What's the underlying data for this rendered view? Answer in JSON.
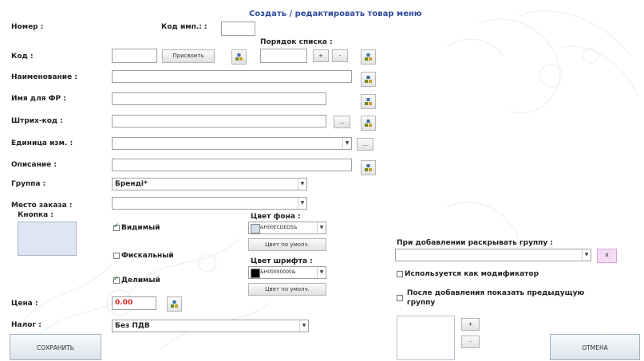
{
  "title": "Создать / редактировать товар меню",
  "labels": {
    "number": "Номер :",
    "import_code": "Код имп.: :",
    "list_order": "Порядок списка :",
    "code": "Код :",
    "name": "Наименование :",
    "fr_name": "Имя для ФР :",
    "barcode": "Штрих-код :",
    "unit": "Единица изм. :",
    "description": "Описание :",
    "group": "Группа :",
    "order_place": "Место заказа :",
    "button": "Кнопка :",
    "bg_color": "Цвет фона :",
    "font_color": "Цвет шрифта :",
    "price": "Цена :",
    "tax": "Налог :",
    "expand_group": "При добавлении раскрывать группу :"
  },
  "buttons": {
    "assign": "Присвоить",
    "plus": "+",
    "minus": "-",
    "dots": "...",
    "default_color": "Цвет по умолч.",
    "x": "x",
    "save": "СОХРАНИТЬ",
    "cancel": "ОТМЕНА"
  },
  "fields": {
    "price_value": "0.00",
    "group_value": "Бренді*",
    "tax_value": "Без ПДВ",
    "bg_color_value": "&H00ECDED5&",
    "font_color_value": "&H00000000&"
  },
  "checkboxes": {
    "visible": {
      "label": "Видимый",
      "checked": true
    },
    "fiscal": {
      "label": "Фискальный",
      "checked": false
    },
    "divisible": {
      "label": "Делимый",
      "checked": true
    },
    "modifier": {
      "label": "Используется как модификатор",
      "checked": false
    },
    "show_prev_line1": "После добавления показать предыдущую",
    "show_prev_line2": "группу",
    "show_prev_checked": false
  },
  "colors": {
    "title": "#2e4a9a",
    "price": "#e02020",
    "bg_swatch": "#d5deec",
    "font_swatch": "#000000",
    "x_button_bg": "#f4dcf6",
    "button_preview": "#dde6f2"
  },
  "icons": {
    "db_icon": "database-stack-icon"
  }
}
